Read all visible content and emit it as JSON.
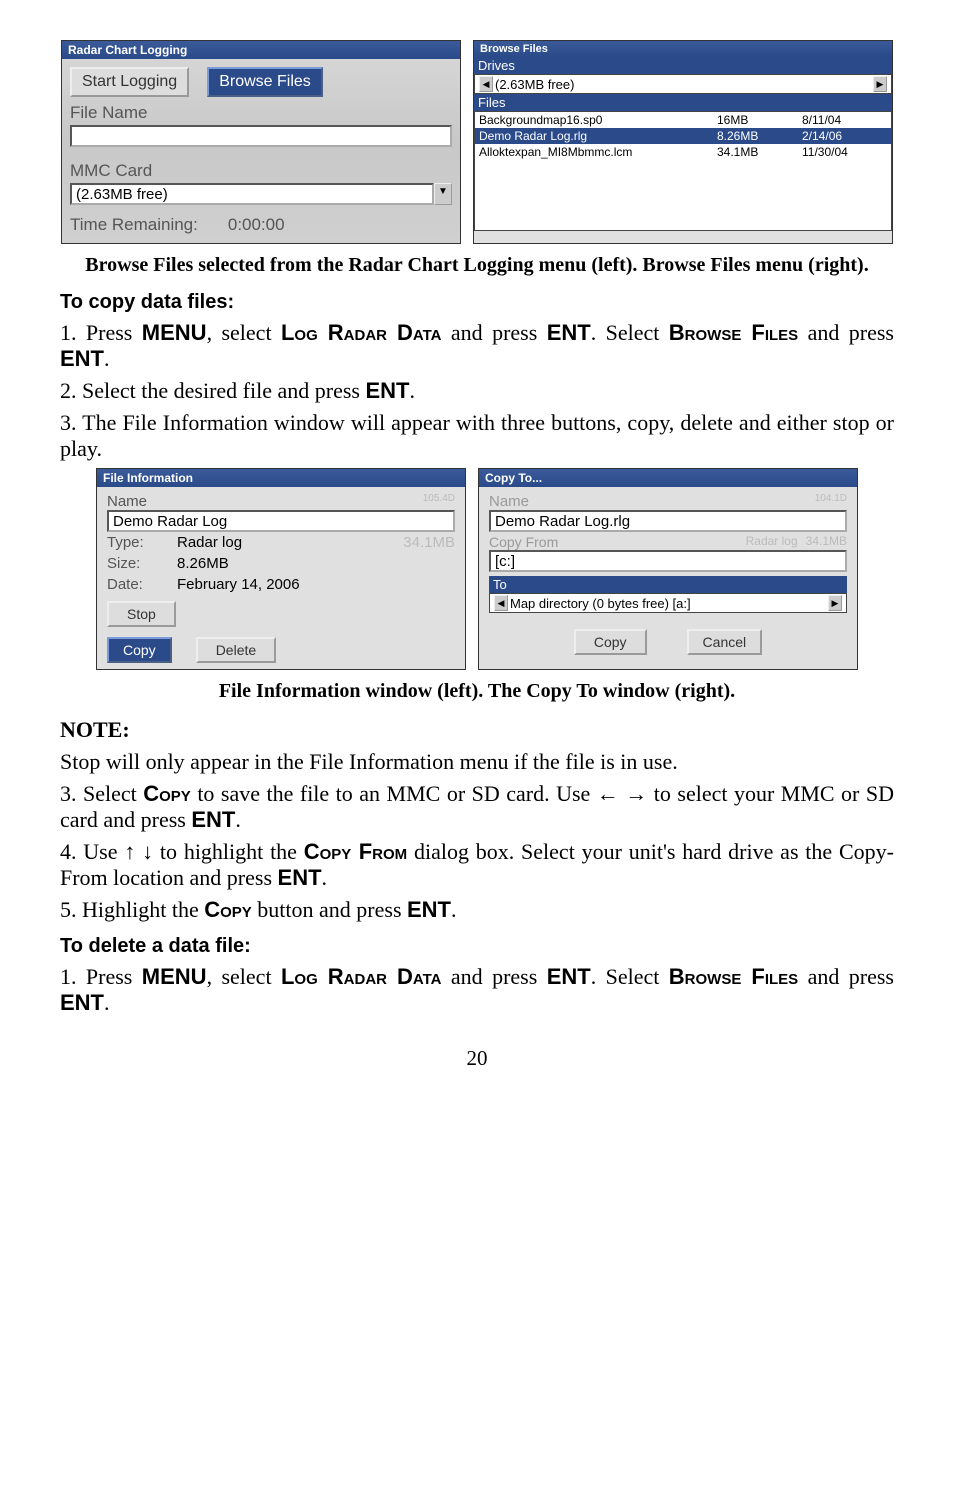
{
  "shot1": {
    "title": "Radar Chart Logging",
    "start_logging": "Start Logging",
    "browse_files": "Browse Files",
    "file_name_label": "File Name",
    "mmc_label": "MMC Card",
    "mmc_value": "(2.63MB free)",
    "time_label": "Time Remaining:",
    "time_value": "0:00:00"
  },
  "shot2": {
    "title": "Browse Files",
    "drives_label": "Drives",
    "drives_value": "(2.63MB free)",
    "files_label": "Files",
    "rows": [
      {
        "name": "Backgroundmap16.sp0",
        "size": "16MB",
        "date": "8/11/04"
      },
      {
        "name": "Demo Radar Log.rlg",
        "size": "8.26MB",
        "date": "2/14/06"
      },
      {
        "name": "Alloktexpan_MI8Mbmmc.lcm",
        "size": "34.1MB",
        "date": "11/30/04"
      }
    ]
  },
  "caption1": "Browse Files selected from the Radar Chart Logging menu (left). Browse Files menu (right).",
  "heading_copy": "To copy data files:",
  "step1a": "1. Press ",
  "step1_menu": "MENU",
  "step1b": ", select ",
  "step1_log": "Log Radar Data",
  "step1c": " and press ",
  "step1_ent": "ENT",
  "step1d": ". Select ",
  "step1_browse": "Browse Files",
  "step1e": " and press ",
  "step1f": ".",
  "step2": "2. Select the desired file and press ",
  "step3": "3. The File Information window will appear with three buttons, copy, delete and either stop or play.",
  "shot3": {
    "title": "File Information",
    "name_label": "Name",
    "name_hint": "105.4D",
    "name_value": "Demo Radar Log",
    "type_label": "Type:",
    "type_value": "Radar log",
    "type_size": "34.1MB",
    "size_label": "Size:",
    "size_value": "8.26MB",
    "date_label": "Date:",
    "date_value": "February 14, 2006",
    "stop": "Stop",
    "copy": "Copy",
    "delete": "Delete"
  },
  "shot4": {
    "title": "Copy To...",
    "name_label": "Name",
    "name_hint": "104.1D",
    "name_value": "Demo Radar Log.rlg",
    "from_label": "Copy From",
    "from_hint": "Radar log",
    "from_size": "34.1MB",
    "from_value": "[c:]",
    "to_label": "To",
    "to_value": "Map directory  (0 bytes free) [a:]",
    "copy": "Copy",
    "cancel": "Cancel"
  },
  "caption2": "File Information window (left). The Copy To window (right).",
  "note_head": "NOTE:",
  "note_body": "Stop will only appear in the File Information menu if the file is in use.",
  "step3b_a": "3. Select ",
  "step3b_copy": "Copy",
  "step3b_b": " to save the file to an MMC or SD card. Use ← →  to select your MMC or SD card and press ",
  "step4a": "4. Use ↑ ↓ to highlight the ",
  "step4_copyfrom": "Copy From",
  "step4b": " dialog box. Select your unit's hard drive as the Copy-From location and press ",
  "step5a": "5. Highlight the ",
  "step5b": " button and press ",
  "heading_delete": "To delete a data file:",
  "del1a": "1. Press ",
  "del1b": ", select ",
  "del1c": " and press ",
  "del1d": ". Select ",
  "del1e": " and press ",
  "page": "20"
}
